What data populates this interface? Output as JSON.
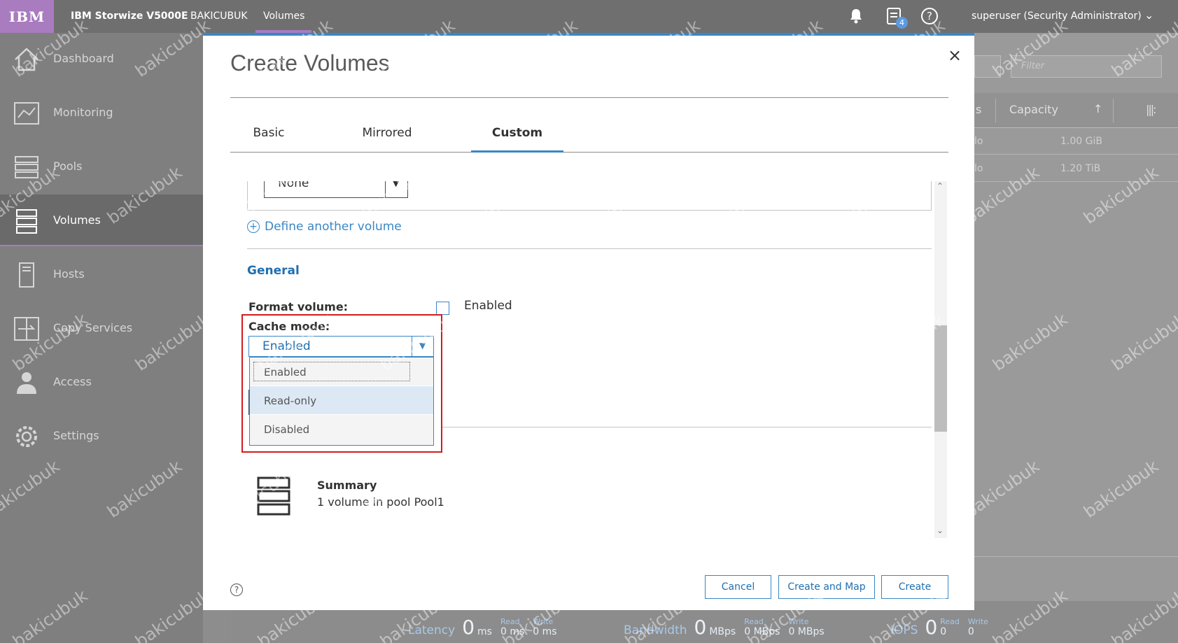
{
  "topbar": {
    "logo": "IBM",
    "product": "IBM Storwize V5000E",
    "system": "BAKICUBUK",
    "page": "Volumes",
    "tasks_count": "4",
    "user": "superuser (Security Administrator)",
    "accent_color": "#a97bbf"
  },
  "sidebar": {
    "items": [
      {
        "label": "Dashboard",
        "icon": "home-icon"
      },
      {
        "label": "Monitoring",
        "icon": "monitoring-icon"
      },
      {
        "label": "Pools",
        "icon": "pools-icon"
      },
      {
        "label": "Volumes",
        "icon": "volumes-icon",
        "active": true
      },
      {
        "label": "Hosts",
        "icon": "hosts-icon"
      },
      {
        "label": "Copy Services",
        "icon": "copy-services-icon"
      },
      {
        "label": "Access",
        "icon": "access-icon"
      },
      {
        "label": "Settings",
        "icon": "gear-icon"
      }
    ]
  },
  "background": {
    "filter_placeholder": "Filter",
    "col_partial": "s",
    "col_capacity": "Capacity",
    "rows": [
      {
        "c1": "lo",
        "c2": "1.00 GiB"
      },
      {
        "c1": "lo",
        "c2": "1.20 TiB"
      }
    ]
  },
  "statusbar": {
    "latency": {
      "label": "Latency",
      "value": "0",
      "unit": "ms",
      "read_label": "Read",
      "read": "0 ms",
      "write_label": "Write",
      "write": "0 ms"
    },
    "bandwidth": {
      "label": "Bandwidth",
      "value": "0",
      "unit": "MBps",
      "read_label": "Read",
      "read": "0 MBps",
      "write_label": "Write",
      "write": "0 MBps"
    },
    "iops": {
      "label": "IOPS",
      "value": "0",
      "read_label": "Read",
      "read": "0",
      "write_label": "Write",
      "write": "0"
    }
  },
  "modal": {
    "title": "Create Volumes",
    "close": "×",
    "tabs": [
      {
        "label": "Basic"
      },
      {
        "label": "Mirrored"
      },
      {
        "label": "Custom",
        "active": true
      }
    ],
    "none_select_value": "None",
    "define_another": "Define another volume",
    "general_heading": "General",
    "format_volume_label": "Format volume:",
    "format_volume_option": "Enabled",
    "cache_mode_label": "Cache mode:",
    "cache_mode_value": "Enabled",
    "cache_mode_options": [
      "Enabled",
      "Read-only",
      "Disabled"
    ],
    "summary_title": "Summary",
    "summary_text": "1 volume in pool Pool1",
    "help": "?",
    "buttons": {
      "cancel": "Cancel",
      "create_and_map": "Create and Map",
      "create": "Create"
    },
    "accent_color": "#3a87c5",
    "highlight_color": "#d21c1c"
  },
  "watermark": "bakicubuk"
}
